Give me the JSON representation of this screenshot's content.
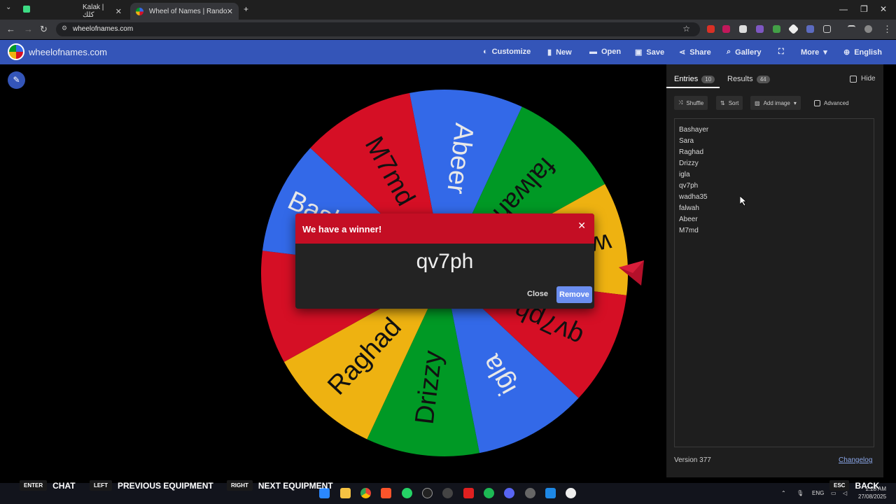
{
  "browser": {
    "tabs": [
      {
        "title": "Kalak | كلك",
        "active": false
      },
      {
        "title": "Wheel of Names | Random nam",
        "active": true
      }
    ],
    "url": "wheelofnames.com"
  },
  "header": {
    "site_name": "wheelofnames.com",
    "menu": [
      {
        "label": "Customize",
        "icon": "palette-icon"
      },
      {
        "label": "New",
        "icon": "file-icon"
      },
      {
        "label": "Open",
        "icon": "folder-icon"
      },
      {
        "label": "Save",
        "icon": "save-icon"
      },
      {
        "label": "Share",
        "icon": "share-icon"
      },
      {
        "label": "Gallery",
        "icon": "search-icon"
      },
      {
        "label": "",
        "icon": "fullscreen-icon"
      },
      {
        "label": "More",
        "icon": "chevron-down-icon"
      },
      {
        "label": "English",
        "icon": "globe-icon"
      }
    ]
  },
  "wheel": {
    "segments": [
      {
        "name": "Abeer",
        "color": "#3369e8"
      },
      {
        "name": "falwah",
        "color": "#009925"
      },
      {
        "name": "wadha35",
        "color": "#eeb211"
      },
      {
        "name": "qv7ph",
        "color": "#d50f25"
      },
      {
        "name": "igla",
        "color": "#3369e8"
      },
      {
        "name": "Drizzy",
        "color": "#009925"
      },
      {
        "name": "Raghad",
        "color": "#eeb211"
      },
      {
        "name": "Sara",
        "color": "#d50f25"
      },
      {
        "name": "Bashayer",
        "color": "#3369e8"
      },
      {
        "name": "M7md",
        "color": "#d50f25"
      }
    ]
  },
  "dialog": {
    "title": "We have a winner!",
    "winner": "qv7ph",
    "close_label": "Close",
    "remove_label": "Remove"
  },
  "panel": {
    "entries_tab": "Entries",
    "entries_count": "10",
    "results_tab": "Results",
    "results_count": "44",
    "hide_label": "Hide",
    "tools": {
      "shuffle": "Shuffle",
      "sort": "Sort",
      "add_image": "Add image",
      "advanced": "Advanced"
    },
    "entries": [
      "Bashayer",
      "Sara",
      "Raghad",
      "Drizzy",
      "igla",
      "qv7ph",
      "wadha35",
      "falwah",
      "Abeer",
      "M7md"
    ],
    "version": "Version 377",
    "changelog": "Changelog"
  },
  "overlay_hints": [
    {
      "key": "ENTER",
      "label": "CHAT"
    },
    {
      "key": "LEFT",
      "label": "PREVIOUS EQUIPMENT"
    },
    {
      "key": "RIGHT",
      "label": "NEXT EQUIPMENT"
    },
    {
      "key": "ESC",
      "label": "BACK"
    }
  ],
  "taskbar": {
    "language": "ENG",
    "time": "2:28 AM",
    "date": "27/08/2025"
  }
}
